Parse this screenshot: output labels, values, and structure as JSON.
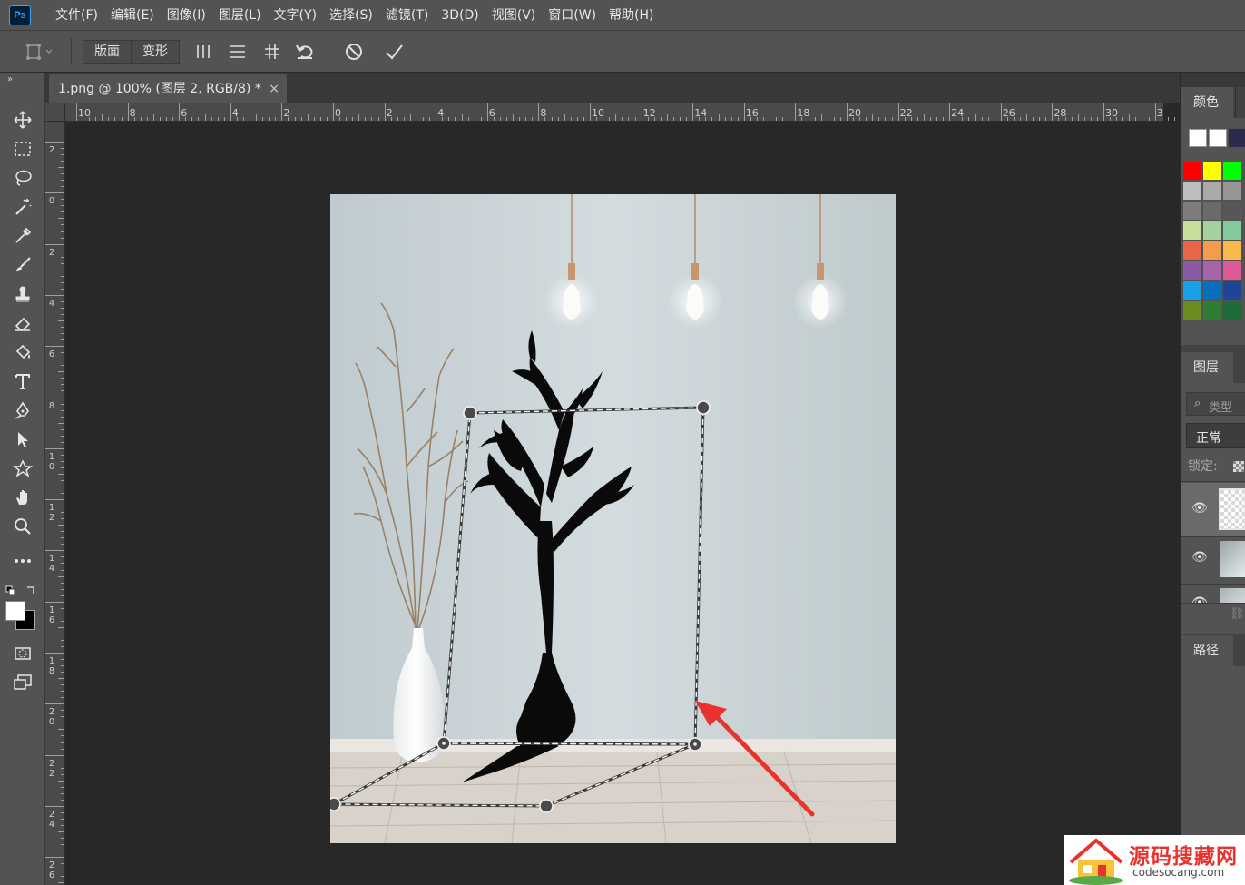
{
  "app": {
    "logo_text": "Ps"
  },
  "menubar": {
    "items": [
      "文件(F)",
      "编辑(E)",
      "图像(I)",
      "图层(L)",
      "文字(Y)",
      "选择(S)",
      "滤镜(T)",
      "3D(D)",
      "视图(V)",
      "窗口(W)",
      "帮助(H)"
    ]
  },
  "options_bar": {
    "mode_buttons": [
      "版面",
      "变形"
    ],
    "icons": [
      "vertical-lines-icon",
      "horizontal-lines-icon",
      "grid-icon",
      "undo-icon",
      "cancel-icon",
      "commit-check-icon"
    ]
  },
  "tools": [
    "move-icon",
    "marquee-icon",
    "lasso-icon",
    "magic-wand-icon",
    "eyedropper-icon",
    "brush-icon",
    "stamp-icon",
    "eraser-icon",
    "paint-bucket-icon",
    "type-icon",
    "pen-icon",
    "path-selection-icon",
    "custom-shape-icon",
    "hand-icon",
    "zoom-icon",
    "more-tools-icon"
  ],
  "document": {
    "tab_title": "1.png @ 100% (图层 2, RGB/8) *",
    "close_glyph": "×"
  },
  "rulers": {
    "horizontal": [
      "10",
      "8",
      "6",
      "4",
      "2",
      "0",
      "2",
      "4",
      "6",
      "8",
      "10",
      "12",
      "14",
      "16",
      "18",
      "20",
      "22",
      "24",
      "26",
      "28",
      "30",
      "3"
    ],
    "vertical": [
      "2",
      "0",
      "2",
      "4",
      "6",
      "8",
      "10",
      "12",
      "14",
      "16",
      "18",
      "20",
      "22",
      "24",
      "26"
    ]
  },
  "panels": {
    "color_tab": "颜色",
    "layers_tab": "图层",
    "layers_search_placeholder": "类型",
    "blend_mode": "正常",
    "lock_label": "锁定:",
    "paths_tab": "路径"
  },
  "colors": {
    "ui_bg": "#535353",
    "canvas_bg": "#282828",
    "accent": "#31a8ff",
    "arrow": "#e8322c",
    "wall": "#c4ced2",
    "floor": "#d8d2cb"
  },
  "watermark": {
    "title": "源码搜藏网",
    "subtitle": "codesocang.com"
  }
}
